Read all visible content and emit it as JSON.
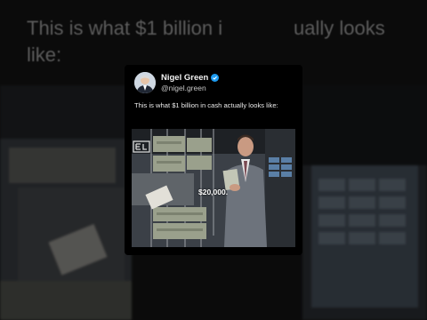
{
  "background": {
    "headline_line1_left": "This is what $1 billion i",
    "headline_line1_right": "ually looks",
    "headline_line2": "like:"
  },
  "tweet": {
    "author_name": "Nigel Green",
    "handle": "@nigel.green",
    "verified": true,
    "text": "This is what $1 billion in cash actually looks like:"
  },
  "video": {
    "caption": "$20,000.",
    "channel_logo_icon": "el-logo-icon"
  },
  "colors": {
    "background": "#000000",
    "verified_badge": "#1d9bf0",
    "text": "#eaeaea"
  }
}
